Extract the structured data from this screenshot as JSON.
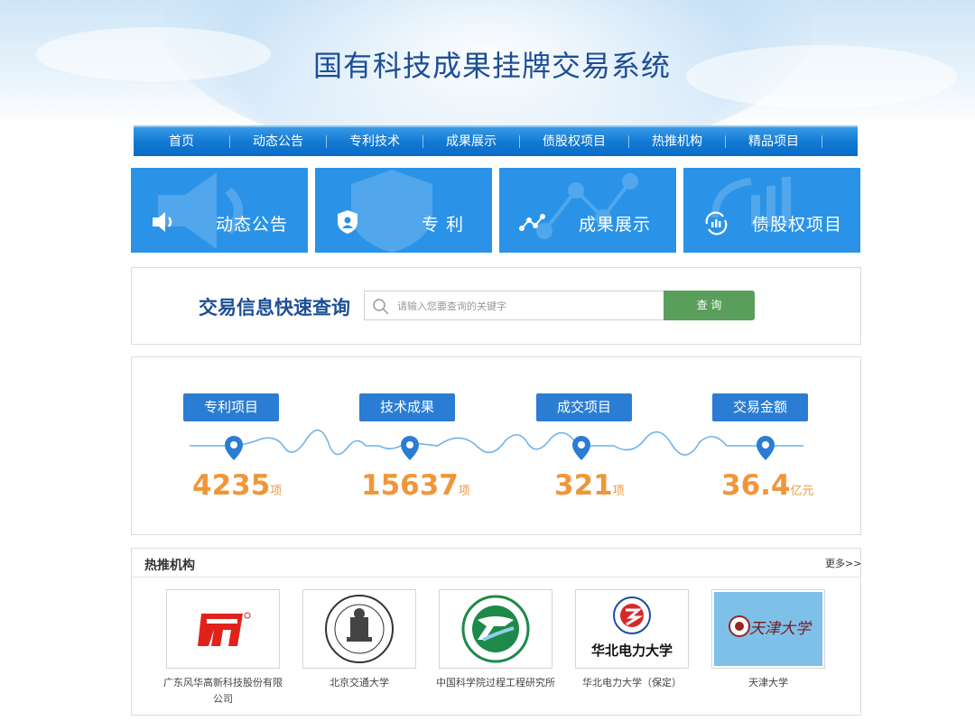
{
  "header": {
    "title": "国有科技成果挂牌交易系统"
  },
  "nav": [
    {
      "label": "首页"
    },
    {
      "label": "动态公告"
    },
    {
      "label": "专利技术"
    },
    {
      "label": "成果展示"
    },
    {
      "label": "债股权项目"
    },
    {
      "label": "热推机构"
    },
    {
      "label": "精品项目"
    }
  ],
  "tiles": [
    {
      "label": "动态公告",
      "icon": "speaker-icon"
    },
    {
      "label": "专 利",
      "icon": "shield-icon"
    },
    {
      "label": "成果展示",
      "icon": "network-icon"
    },
    {
      "label": "债股权项目",
      "icon": "chart-refresh-icon"
    }
  ],
  "search": {
    "title": "交易信息快速查询",
    "placeholder": "请输入您要查询的关键字",
    "button": "查 询"
  },
  "stats": [
    {
      "label": "专利项目",
      "value": "4235",
      "unit": "项"
    },
    {
      "label": "技术成果",
      "value": "15637",
      "unit": "项"
    },
    {
      "label": "成交项目",
      "value": "321",
      "unit": "项"
    },
    {
      "label": "交易金额",
      "value": "36.4",
      "unit": "亿元"
    }
  ],
  "institutions": {
    "title": "热推机构",
    "more": "更多>>",
    "items": [
      {
        "name": "广东风华高新科技股份有限公司"
      },
      {
        "name": "北京交通大学"
      },
      {
        "name": "中国科学院过程工程研究所"
      },
      {
        "name": "华北电力大学（保定）"
      },
      {
        "name": "天津大学"
      }
    ]
  },
  "colors": {
    "brand_blue": "#1d4e96",
    "nav_blue": "#137ad4",
    "tile_blue": "#2a93e8",
    "stat_orange": "#f0963a",
    "search_green": "#5a9e5c"
  }
}
